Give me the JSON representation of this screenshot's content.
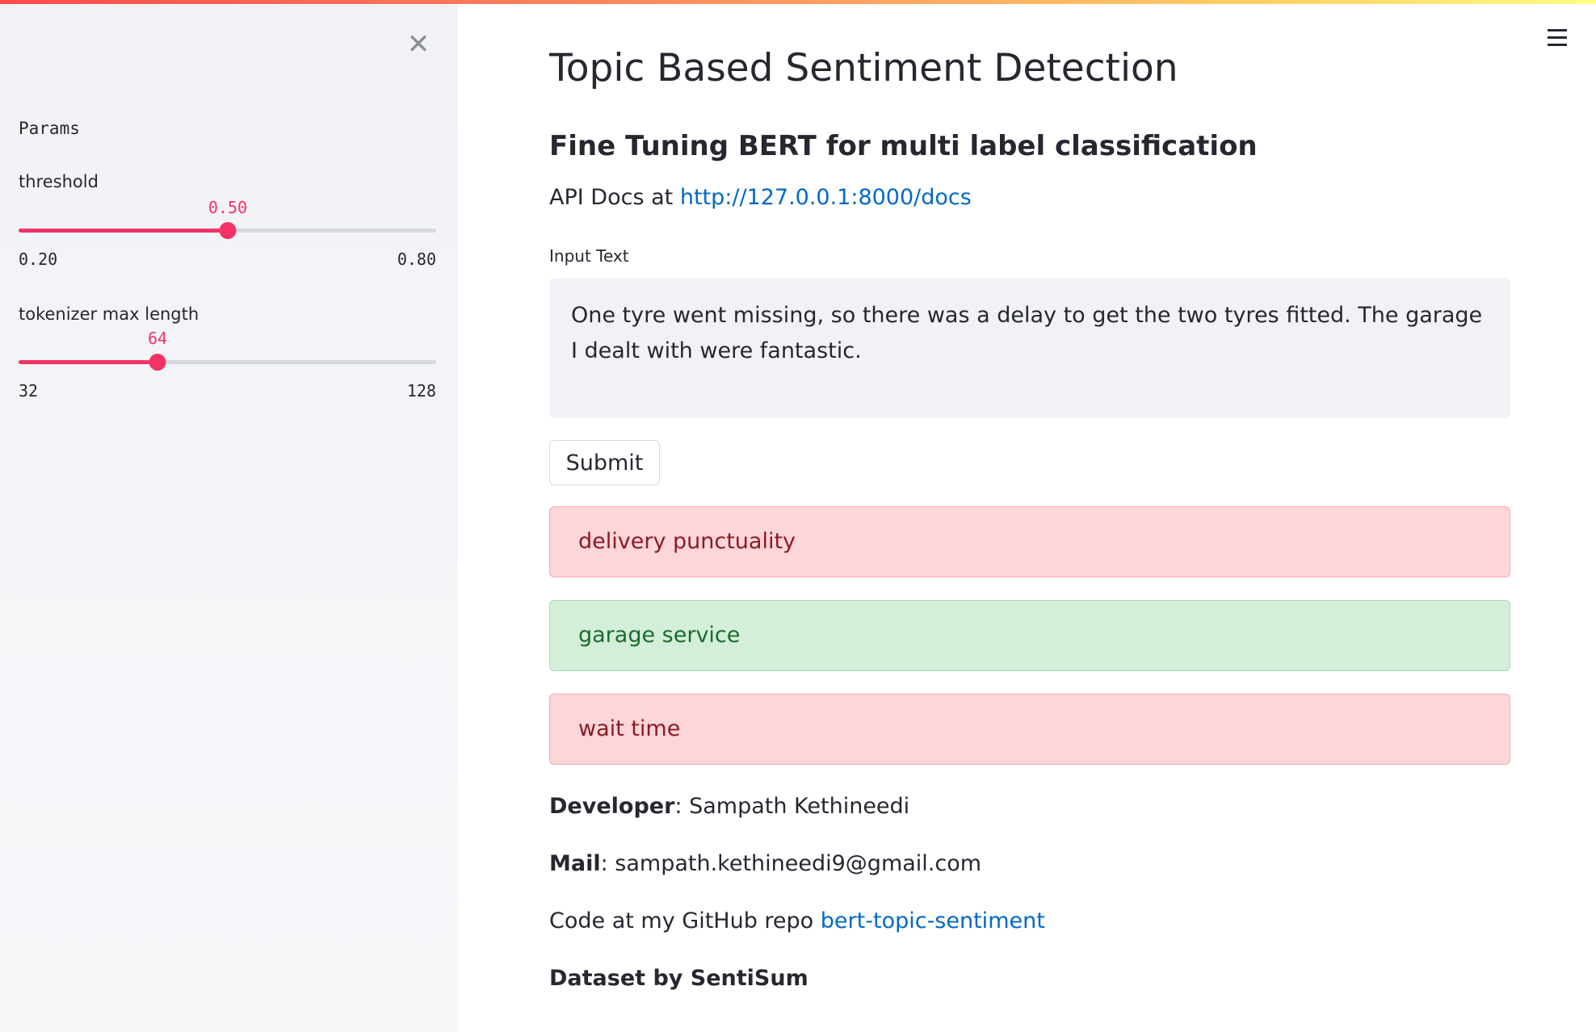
{
  "sidebar": {
    "params_title": "Params",
    "sliders": [
      {
        "label": "threshold",
        "value": 0.5,
        "value_text": "0.50",
        "min_text": "0.20",
        "max_text": "0.80",
        "fraction": 0.5
      },
      {
        "label": "tokenizer max length",
        "value": 64,
        "value_text": "64",
        "min_text": "32",
        "max_text": "128",
        "fraction": 0.3333
      }
    ]
  },
  "main": {
    "title": "Topic Based Sentiment Detection",
    "subtitle": "Fine Tuning BERT for multi label classification",
    "api_prefix": "API Docs at ",
    "api_link": "http://127.0.0.1:8000/docs",
    "input_label": "Input Text",
    "input_value": "One tyre went missing, so there was a delay to get the two tyres fitted. The garage I dealt with were fantastic.",
    "submit_label": "Submit",
    "results": [
      {
        "label": "delivery punctuality",
        "sentiment": "negative"
      },
      {
        "label": "garage service",
        "sentiment": "positive"
      },
      {
        "label": "wait time",
        "sentiment": "negative"
      }
    ],
    "developer_label": "Developer",
    "developer_value": ": Sampath Kethineedi",
    "mail_label": "Mail",
    "mail_value": ": sampath.kethineedi9@gmail.com",
    "code_prefix": "Code at my GitHub repo ",
    "code_link": "bert-topic-sentiment",
    "dataset_text": "Dataset by SentiSum"
  },
  "colors": {
    "accent": "#f63366",
    "link": "#0068c9",
    "negative_bg": "#fdd6d9",
    "positive_bg": "#d3eed9"
  }
}
